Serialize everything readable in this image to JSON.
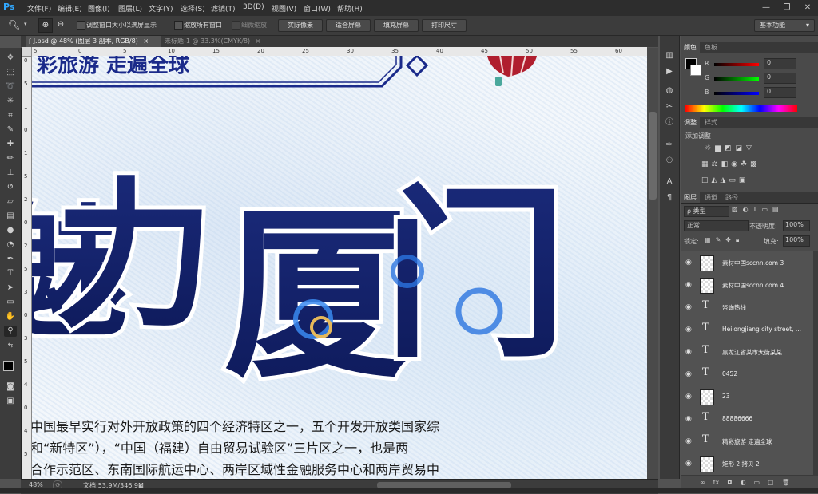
{
  "app": {
    "logo": "Ps",
    "menu": [
      "文件(F)",
      "编辑(E)",
      "图像(I)",
      "图层(L)",
      "文字(Y)",
      "选择(S)",
      "滤镜(T)",
      "3D(D)",
      "视图(V)",
      "窗口(W)",
      "帮助(H)"
    ],
    "workspace": "基本功能"
  },
  "options": {
    "chk1": "调整窗口大小以满屏显示",
    "chk2": "缩放所有窗口",
    "chk3": "细微缩放",
    "btn1": "实际像素",
    "btn2": "适合屏幕",
    "btn3": "填充屏幕",
    "btn4": "打印尺寸"
  },
  "tabs": {
    "active": "门.psd @ 48% (图层 3 副本, RGB/8)",
    "inactive": "未标题-1 @ 33.3%(CMYK/8)",
    "close": "×"
  },
  "ruler": {
    "h": [
      "5",
      "0",
      "5",
      "10",
      "15",
      "20",
      "25",
      "30",
      "35",
      "40",
      "45",
      "50",
      "55",
      "60"
    ],
    "v": [
      "0",
      "5",
      "1",
      "0",
      "1",
      "5",
      "2",
      "0",
      "2",
      "5",
      "3",
      "0",
      "3",
      "5",
      "4",
      "0",
      "4",
      "5"
    ]
  },
  "canvas": {
    "banner": "彩旅游    走遍全球",
    "big_char1": "力",
    "big_char2": "厦",
    "big_char3": "门",
    "leading_fragment": "魅",
    "para1": "中国最早实行对外开放政策的四个经济特区之一，五个开发开放类国家综",
    "para2": "和“新特区”），“中国（福建）自由贸易试验区”三片区之一，也是两",
    "para3": "合作示范区、东南国际航运中心、两岸区域性金融服务中心和两岸贸易中"
  },
  "status": {
    "zoom": "48%",
    "doc": "文档:53.9M/346.9M"
  },
  "color_panel": {
    "tab1": "颜色",
    "tab2": "色板",
    "r_label": "R",
    "g_label": "G",
    "b_label": "B",
    "r": "0",
    "g": "0",
    "b": "0"
  },
  "adjust_panel": {
    "tab1": "调整",
    "tab2": "样式",
    "title": "添加调整"
  },
  "layers_panel": {
    "tab1": "图层",
    "tab2": "通道",
    "tab3": "路径",
    "kind": "ρ 类型",
    "blend": "正常",
    "opacity_label": "不透明度:",
    "opacity": "100%",
    "lock_label": "锁定:",
    "fill_label": "填充:",
    "fill": "100%",
    "layers": [
      {
        "type": "image",
        "name": "素材中国sccnn.com 3"
      },
      {
        "type": "image",
        "name": "素材中国sccnn.com 4"
      },
      {
        "type": "text",
        "name": "咨询热线"
      },
      {
        "type": "text",
        "name": "Heilongjiang city street, ..."
      },
      {
        "type": "text",
        "name": "黑龙江省某市大街某某..."
      },
      {
        "type": "text",
        "name": "0452"
      },
      {
        "type": "checker",
        "name": "23"
      },
      {
        "type": "text",
        "name": "88886666"
      },
      {
        "type": "text",
        "name": "精彩旅游  走遍全球"
      },
      {
        "type": "checker",
        "name": "矩形 2 拷贝 2"
      }
    ]
  },
  "colors": {
    "ink": "#1a2a7a",
    "cloud": "#2a74e0",
    "gold": "#e5b85a"
  }
}
